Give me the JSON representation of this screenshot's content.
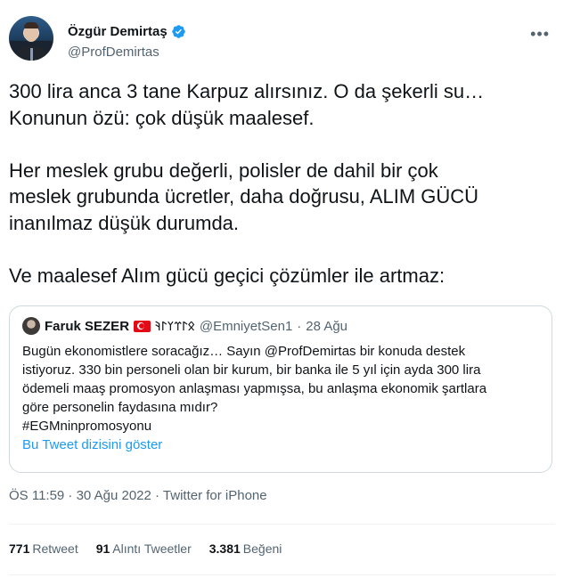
{
  "author": {
    "display_name": "Özgür Demirtaş",
    "handle": "@ProfDemirtas",
    "verified": true,
    "avatar_icon": "profile-photo",
    "more_icon": "more-horizontal-icon"
  },
  "tweet": {
    "paragraphs": [
      "300 lira anca 3 tane Karpuz alırsınız. O da şekerli su…\nKonunun özü: çok düşük maalesef.",
      "Her meslek grubu değerli, polisler de dahil bir çok\nmeslek grubunda ücretler, daha doğrusu, ALIM GÜCÜ\ninanılmaz düşük durumda.",
      "Ve maalesef Alım gücü geçici çözümler ile artmaz:"
    ]
  },
  "quote": {
    "display_name": "Faruk SEZER",
    "flag": "turkey-flag",
    "runes": "𐰋𐰃𐰼𐰠𐰃𐰚",
    "handle": "@EmniyetSen1",
    "separator": "·",
    "date": "28 Ağu",
    "text": "Bugün ekonomistlere soracağız… Sayın @ProfDemirtas bir konuda destek\nistiyoruz. 330 bin personeli olan bir kurum, bir banka ile 5 yıl için ayda 300 lira\nödemeli maaş promosyon anlaşması yapmışsa, bu anlaşma ekonomik şartlara\ngöre personelin faydasına mıdır?\n#EGMninpromosyonu",
    "show_thread": "Bu Tweet dizisini göster"
  },
  "timestamp": "ÖS 11:59 · 30 Ağu 2022 · Twitter for iPhone",
  "stats": {
    "retweets_count": "771",
    "retweets_label": "Retweet",
    "quotes_count": "91",
    "quotes_label": "Alıntı Tweetler",
    "likes_count": "3.381",
    "likes_label": "Beğeni"
  },
  "colors": {
    "text": "#0f1419",
    "secondary": "#536471",
    "link": "#1d9bf0",
    "border": "#cfd9de",
    "verified": "#1d9bf0"
  }
}
